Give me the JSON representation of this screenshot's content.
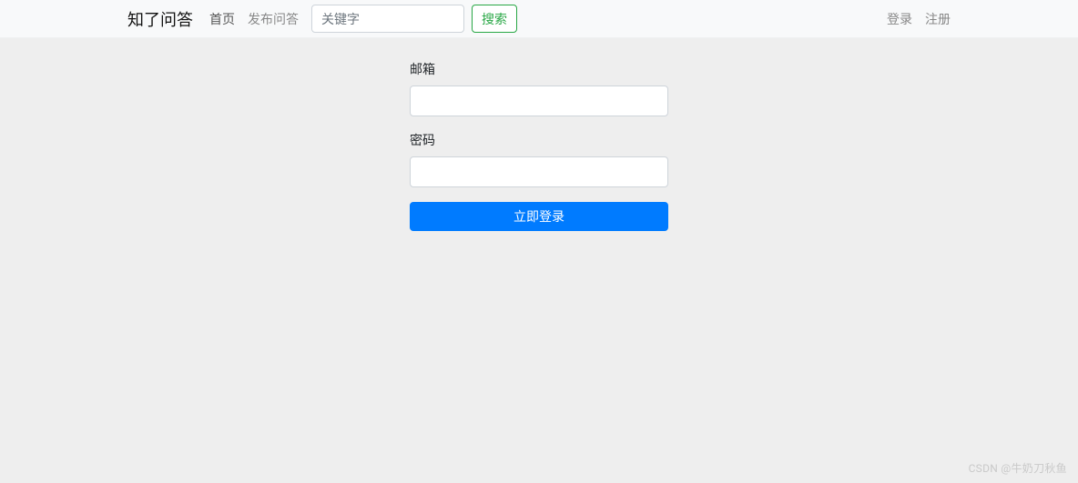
{
  "navbar": {
    "brand": "知了问答",
    "home": "首页",
    "post": "发布问答",
    "search_placeholder": "关键字",
    "search_btn": "搜索",
    "login": "登录",
    "register": "注册"
  },
  "form": {
    "email_label": "邮箱",
    "password_label": "密码",
    "submit": "立即登录"
  },
  "watermark": "CSDN @牛奶刀秋鱼"
}
